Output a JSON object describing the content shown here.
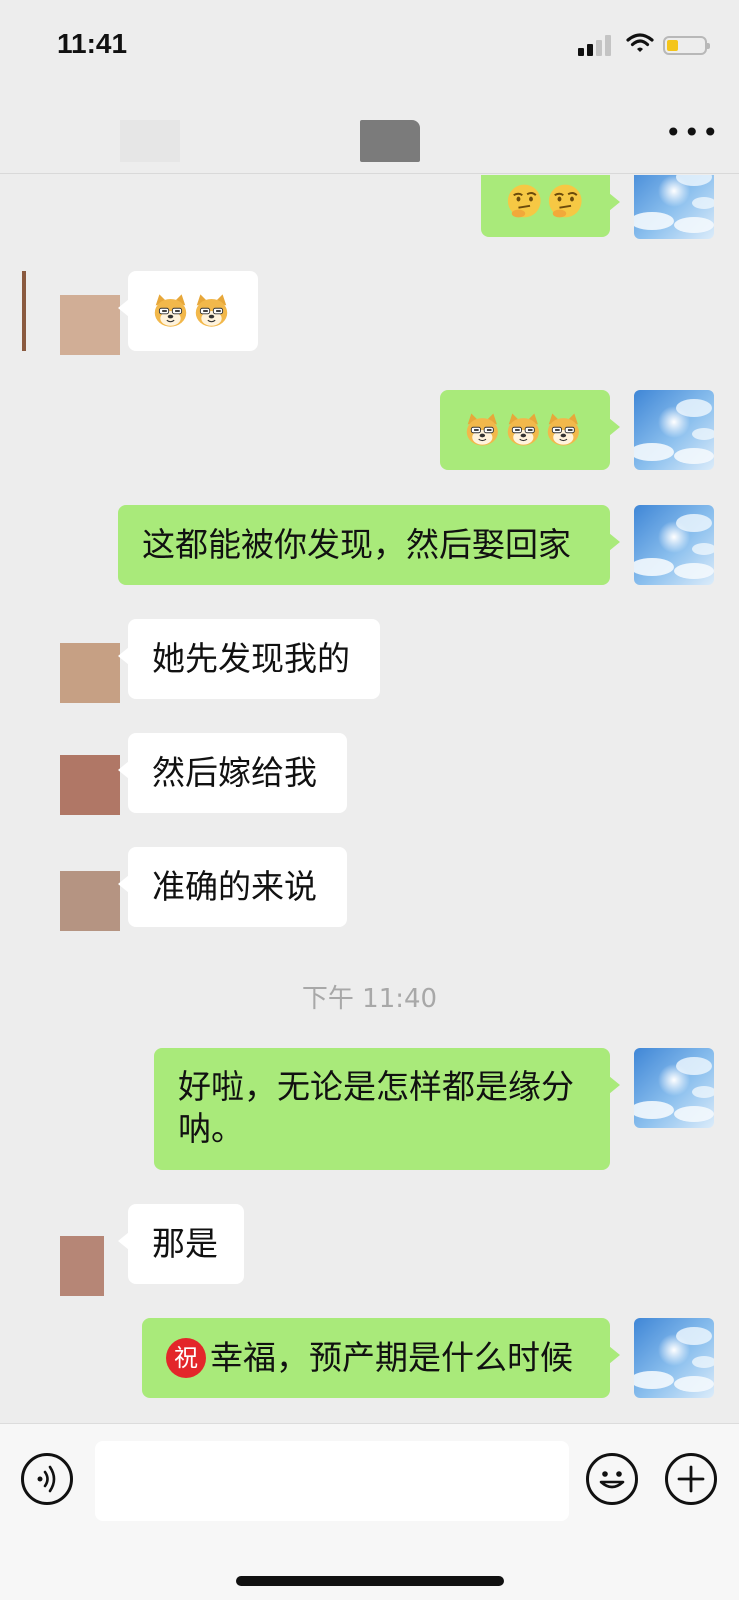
{
  "status": {
    "time": "11:41"
  },
  "messages": [
    {
      "side": "right",
      "type": "emoji",
      "emoji": "thinking-face x2"
    },
    {
      "side": "left",
      "type": "emoji",
      "emoji": "doge x2"
    },
    {
      "side": "right",
      "type": "emoji",
      "emoji": "doge x3"
    },
    {
      "side": "right",
      "text": "这都能被你发现，然后娶回家"
    },
    {
      "side": "left",
      "text": "她先发现我的"
    },
    {
      "side": "left",
      "text": "然后嫁给我"
    },
    {
      "side": "left",
      "text": "准确的来说"
    },
    {
      "type": "timestamp",
      "text": "下午 11:40"
    },
    {
      "side": "right",
      "text_line1": "好啦，无论是怎样都是缘分",
      "text_line2": "呐。"
    },
    {
      "side": "left",
      "text": "那是"
    },
    {
      "side": "right",
      "badge": "祝",
      "text": "幸福，预产期是什么时候"
    }
  ],
  "input": {
    "placeholder": ""
  }
}
